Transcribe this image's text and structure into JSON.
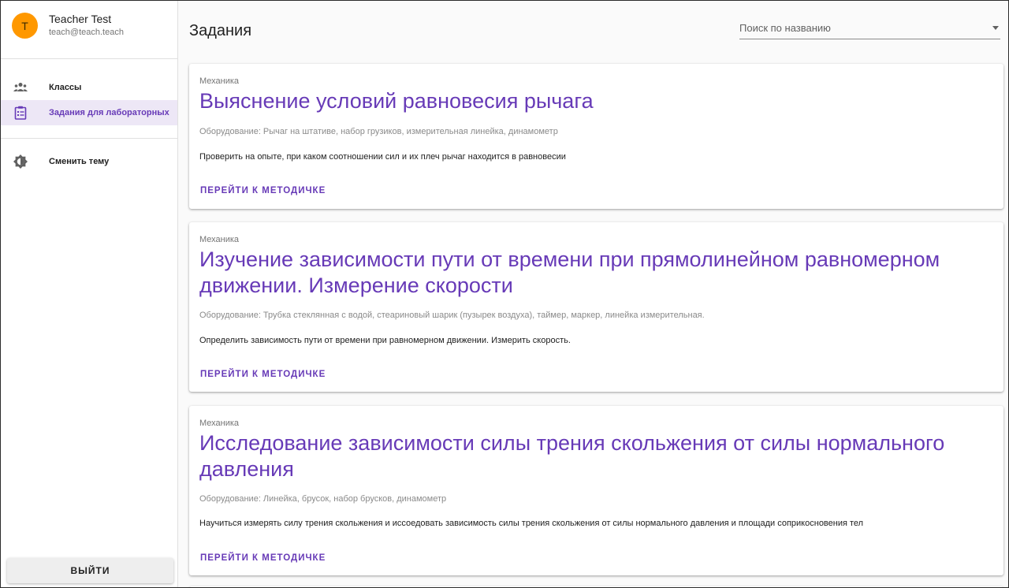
{
  "user": {
    "initial": "T",
    "name": "Teacher Test",
    "email": "teach@teach.teach"
  },
  "nav": {
    "items": [
      {
        "label": "Классы",
        "icon": "people-icon"
      },
      {
        "label": "Задания для лабораторных",
        "icon": "clipboard-icon"
      }
    ],
    "theme_label": "Сменить тему",
    "theme_icon": "brightness-icon"
  },
  "logout_label": "ВЫЙТИ",
  "page_title": "Задания",
  "search": {
    "placeholder": "Поиск по названию"
  },
  "colors": {
    "accent": "#673ab7",
    "avatar": "#ff9800",
    "active_bg": "#ede7f6"
  },
  "cards": [
    {
      "category": "Механика",
      "title": "Выяснение условий равновесия рычага",
      "equipment": "Оборудование: Рычаг на штативе, набор грузиков, измерительная линейка, динамометр",
      "description": "Проверить на опыте, при каком соотношении сил и их плеч рычаг находится в равновесии",
      "link": "ПЕРЕЙТИ К МЕТОДИЧКЕ"
    },
    {
      "category": "Механика",
      "title": "Изучение зависимости пути от времени при прямолинейном равномерном движении. Измерение скорости",
      "equipment": "Оборудование: Трубка стеклянная с водой, стеариновый шарик (пузырек воздуха), таймер, маркер, линейка измерительная.",
      "description": "Определить зависимость пути от времени при равномерном движении. Измерить скорость.",
      "link": "ПЕРЕЙТИ К МЕТОДИЧКЕ"
    },
    {
      "category": "Механика",
      "title": "Исследование зависимости силы трения скольжения от силы нормального давления",
      "equipment": "Оборудование: Линейка, брусок, набор брусков, динамометр",
      "description": "Научиться измерять силу трения скольжения и иссоедовать зависимость силы трения скольжения от силы нормального давления и площади соприкосновения тел",
      "link": "ПЕРЕЙТИ К МЕТОДИЧКЕ"
    }
  ]
}
